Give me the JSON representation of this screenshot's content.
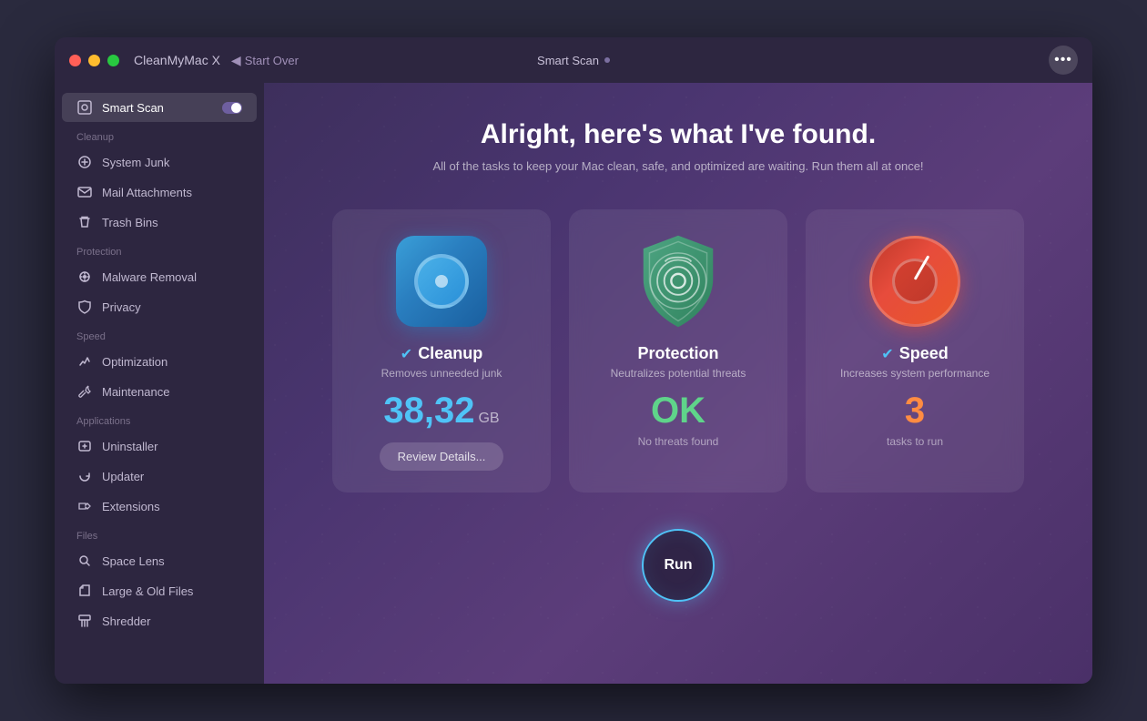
{
  "titlebar": {
    "app_name": "CleanMyMac X",
    "start_over": "Start Over",
    "center_title": "Smart Scan",
    "more_icon": "•••"
  },
  "sidebar": {
    "items_smart_scan": [
      {
        "id": "smart-scan",
        "label": "Smart Scan",
        "icon": "🖥",
        "active": true
      }
    ],
    "section_cleanup": "Cleanup",
    "items_cleanup": [
      {
        "id": "system-junk",
        "label": "System Junk",
        "icon": "⚙"
      },
      {
        "id": "mail-attachments",
        "label": "Mail Attachments",
        "icon": "✉"
      },
      {
        "id": "trash-bins",
        "label": "Trash Bins",
        "icon": "🗑"
      }
    ],
    "section_protection": "Protection",
    "items_protection": [
      {
        "id": "malware-removal",
        "label": "Malware Removal",
        "icon": "☣"
      },
      {
        "id": "privacy",
        "label": "Privacy",
        "icon": "👁"
      }
    ],
    "section_speed": "Speed",
    "items_speed": [
      {
        "id": "optimization",
        "label": "Optimization",
        "icon": "⚡"
      },
      {
        "id": "maintenance",
        "label": "Maintenance",
        "icon": "🔧"
      }
    ],
    "section_applications": "Applications",
    "items_applications": [
      {
        "id": "uninstaller",
        "label": "Uninstaller",
        "icon": "📦"
      },
      {
        "id": "updater",
        "label": "Updater",
        "icon": "🔄"
      },
      {
        "id": "extensions",
        "label": "Extensions",
        "icon": "📎"
      }
    ],
    "section_files": "Files",
    "items_files": [
      {
        "id": "space-lens",
        "label": "Space Lens",
        "icon": "🔍"
      },
      {
        "id": "large-old-files",
        "label": "Large & Old Files",
        "icon": "📁"
      },
      {
        "id": "shredder",
        "label": "Shredder",
        "icon": "🗂"
      }
    ]
  },
  "content": {
    "headline": "Alright, here's what I've found.",
    "subheadline": "All of the tasks to keep your Mac clean, safe, and optimized are waiting. Run them all at once!",
    "cards": [
      {
        "id": "cleanup",
        "title": "Cleanup",
        "subtitle": "Removes unneeded junk",
        "value": "38,32",
        "unit": "GB",
        "note": "",
        "has_review": true,
        "review_label": "Review Details...",
        "has_check": true,
        "value_color": "cyan"
      },
      {
        "id": "protection",
        "title": "Protection",
        "subtitle": "Neutralizes potential threats",
        "value": "OK",
        "unit": "",
        "note": "No threats found",
        "has_review": false,
        "has_check": false,
        "value_color": "green"
      },
      {
        "id": "speed",
        "title": "Speed",
        "subtitle": "Increases system performance",
        "value": "3",
        "unit": "",
        "note": "tasks to run",
        "has_review": false,
        "has_check": true,
        "value_color": "orange"
      }
    ],
    "run_button": "Run"
  }
}
